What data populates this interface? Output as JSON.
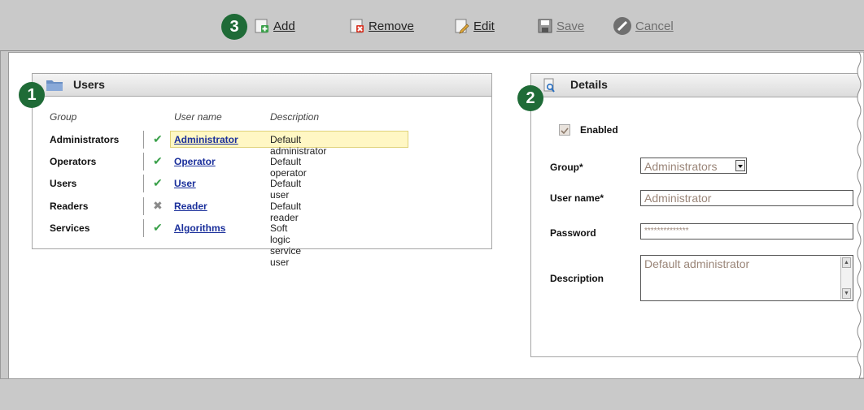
{
  "toolbar": {
    "badge": "3",
    "add_label": "Add",
    "remove_label": "Remove",
    "edit_label": "Edit",
    "save_label": "Save",
    "cancel_label": "Cancel"
  },
  "users_panel": {
    "badge": "1",
    "title": "Users",
    "columns": [
      "Group",
      "User name",
      "Description"
    ],
    "rows": [
      {
        "group": "Administrators",
        "status": "enabled",
        "status_icon": "check-icon",
        "user": "Administrator",
        "description": "Default administrator"
      },
      {
        "group": "Operators",
        "status": "enabled",
        "status_icon": "check-icon",
        "user": "Operator",
        "description": "Default operator"
      },
      {
        "group": "Users",
        "status": "enabled",
        "status_icon": "check-icon",
        "user": "User",
        "description": "Default user"
      },
      {
        "group": "Readers",
        "status": "disabled",
        "status_icon": "cross-icon",
        "user": "Reader",
        "description": "Default reader"
      },
      {
        "group": "Services",
        "status": "enabled",
        "status_icon": "check-icon",
        "user": "Algorithms",
        "description": "Soft logic service user"
      }
    ]
  },
  "details_panel": {
    "badge": "2",
    "title": "Details",
    "enabled_label": "Enabled",
    "enabled_checked": true,
    "group_label": "Group*",
    "group_value": "Administrators",
    "username_label": "User name*",
    "username_value": "Administrator",
    "password_label": "Password",
    "password_value": "**************",
    "description_label": "Description",
    "description_value": "Default administrator"
  },
  "colors": {
    "badge": "#1f6b37",
    "link": "#1a2f9b",
    "check": "#3aa04a",
    "cross": "#8a8a8a",
    "highlight": "#fff7c4"
  }
}
